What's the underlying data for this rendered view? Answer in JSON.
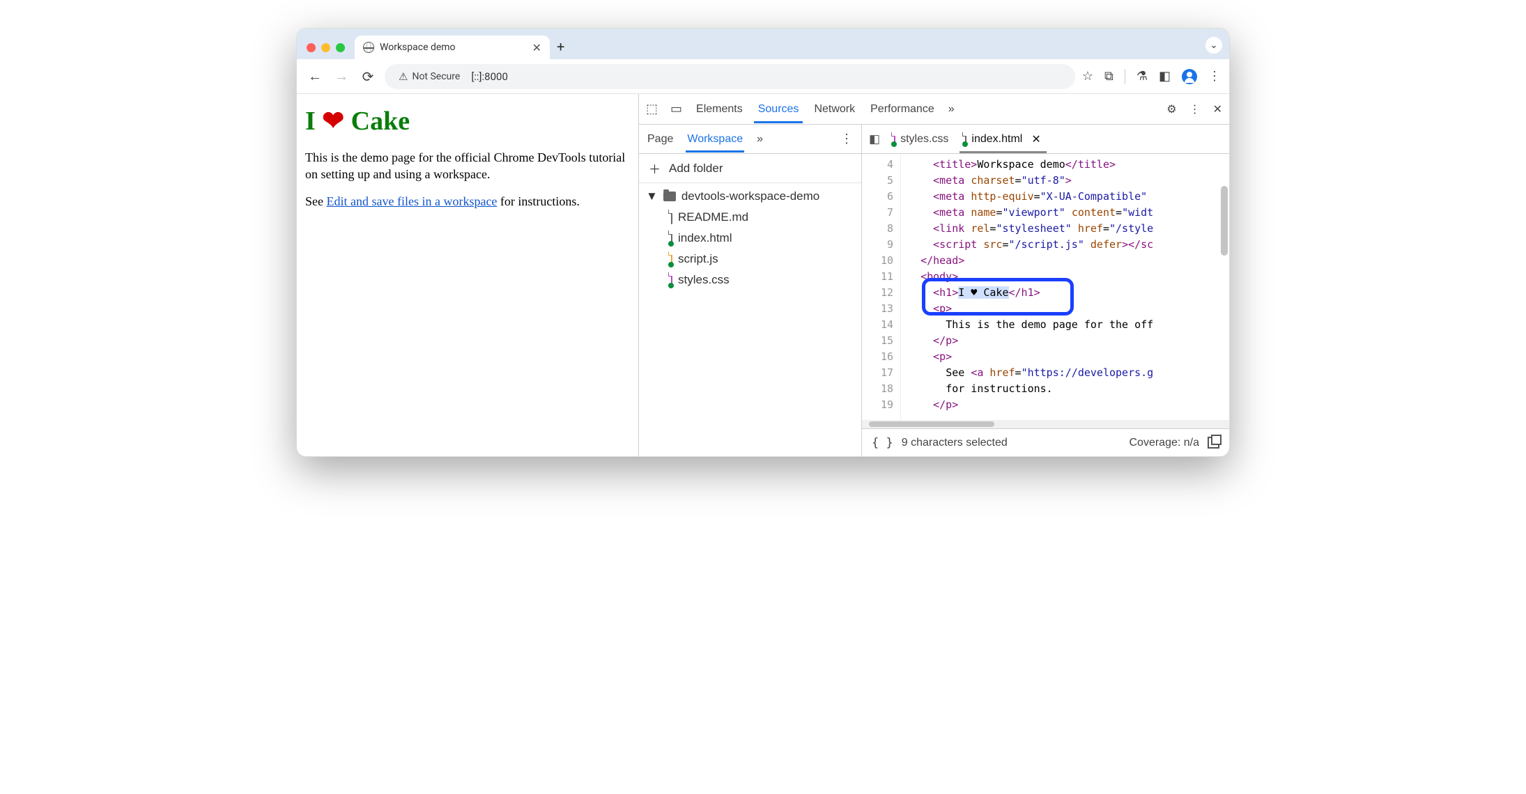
{
  "browser": {
    "tab_title": "Workspace demo",
    "security_label": "Not Secure",
    "url": "[::]:8000"
  },
  "page": {
    "heading_prefix": "I ",
    "heading_heart": "❤",
    "heading_suffix": " Cake",
    "p1": "This is the demo page for the official Chrome DevTools tutorial on setting up and using a workspace.",
    "p2_prefix": "See ",
    "p2_link": "Edit and save files in a workspace",
    "p2_suffix": " for instructions."
  },
  "devtools": {
    "tabs": [
      "Elements",
      "Sources",
      "Network",
      "Performance"
    ],
    "active_tab": "Sources",
    "sidebar": {
      "tabs": [
        "Page",
        "Workspace"
      ],
      "active": "Workspace",
      "add_folder_label": "Add folder",
      "folder": "devtools-workspace-demo",
      "files": [
        "README.md",
        "index.html",
        "script.js",
        "styles.css"
      ]
    },
    "editor": {
      "open_tabs": [
        "styles.css",
        "index.html"
      ],
      "active": "index.html",
      "first_line_no": 4,
      "lines": [
        {
          "n": 4,
          "html": "    <span class='t-tag'>&lt;title&gt;</span><span class='t-txt'>Workspace demo</span><span class='t-tag'>&lt;/title&gt;</span>"
        },
        {
          "n": 5,
          "html": "    <span class='t-tag'>&lt;meta</span> <span class='t-attr'>charset</span>=<span class='t-str'>\"utf-8\"</span><span class='t-tag'>&gt;</span>"
        },
        {
          "n": 6,
          "html": "    <span class='t-tag'>&lt;meta</span> <span class='t-attr'>http-equiv</span>=<span class='t-str'>\"X-UA-Compatible\"</span>"
        },
        {
          "n": 7,
          "html": "    <span class='t-tag'>&lt;meta</span> <span class='t-attr'>name</span>=<span class='t-str'>\"viewport\"</span> <span class='t-attr'>content</span>=<span class='t-str'>\"widt</span>"
        },
        {
          "n": 8,
          "html": "    <span class='t-tag'>&lt;link</span> <span class='t-attr'>rel</span>=<span class='t-str'>\"stylesheet\"</span> <span class='t-attr'>href</span>=<span class='t-str'>\"/style</span>"
        },
        {
          "n": 9,
          "html": "    <span class='t-tag'>&lt;script</span> <span class='t-attr'>src</span>=<span class='t-str'>\"/script.js\"</span> <span class='t-attr'>defer</span><span class='t-tag'>&gt;&lt;/sc</span>"
        },
        {
          "n": 10,
          "html": "  <span class='t-tag'>&lt;/head&gt;</span>"
        },
        {
          "n": 11,
          "html": "  <span class='t-tag'>&lt;body&gt;</span>"
        },
        {
          "n": 12,
          "html": "    <span class='t-tag'>&lt;h1&gt;</span><span class='sel t-txt'>I ♥ Cake</span><span class='t-tag'>&lt;/h1&gt;</span>"
        },
        {
          "n": 13,
          "html": "    <span class='t-tag'>&lt;p&gt;</span>"
        },
        {
          "n": 14,
          "html": "      <span class='t-txt'>This is the demo page for the off</span>"
        },
        {
          "n": 15,
          "html": "    <span class='t-tag'>&lt;/p&gt;</span>"
        },
        {
          "n": 16,
          "html": "    <span class='t-tag'>&lt;p&gt;</span>"
        },
        {
          "n": 17,
          "html": "      <span class='t-txt'>See </span><span class='t-tag'>&lt;a</span> <span class='t-attr'>href</span>=<span class='t-str'>\"https://developers.g</span>"
        },
        {
          "n": 18,
          "html": "      <span class='t-txt'>for instructions.</span>"
        },
        {
          "n": 19,
          "html": "    <span class='t-tag'>&lt;/p&gt;</span>"
        }
      ]
    },
    "status": {
      "selection": "9 characters selected",
      "coverage": "Coverage: n/a"
    }
  }
}
